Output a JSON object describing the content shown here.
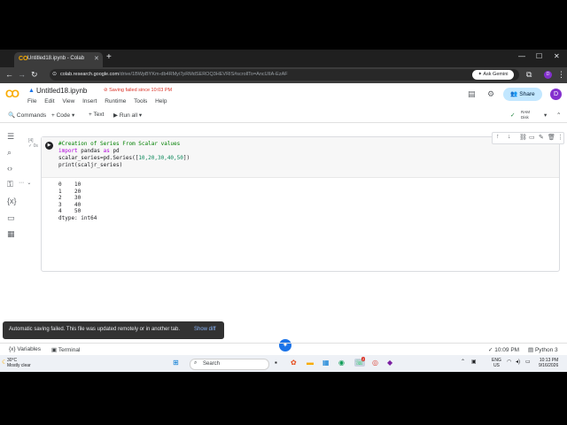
{
  "browser": {
    "tab_title": "Untitled18.ipynb - Colab",
    "url_domain": "colab.research.google.com",
    "url_path": "/drive/1BWpBYKm-db4RMyi7pRMdSEROQ3HEVRIS#scrollTo=AncUIIA-EzAF",
    "gemini_label": "Ask Gemini",
    "profile_initial": "D"
  },
  "colab": {
    "notebook_title": "Untitled18.ipynb",
    "saving_status": "Saving failed since 10:03 PM",
    "menu": [
      "File",
      "Edit",
      "View",
      "Insert",
      "Runtime",
      "Tools",
      "Help"
    ],
    "share_label": "Share",
    "avatar_initial": "D",
    "toolbar": {
      "commands": "Commands",
      "code": "+ Code",
      "text": "+ Text",
      "run_all": "Run all",
      "ram": "RAM",
      "disk": "Disk"
    }
  },
  "cell": {
    "exec_count": "[4]",
    "exec_time": "0s",
    "code": {
      "comment": "#Creation of Series From Scalar values",
      "line2_kw": "import",
      "line2_rest": " pandas ",
      "line2_kw2": "as",
      "line2_alias": " pd",
      "line3_pre": "scalar_series=pd.Series([",
      "line3_nums": "10,20,30,40,50",
      "line3_post": "])",
      "line4": "print(scaljr_series)"
    },
    "output": [
      "0    10",
      "1    20",
      "2    30",
      "3    40",
      "4    50",
      "dtype: int64"
    ]
  },
  "toast": {
    "message": "Automatic saving failed. This file was updated remotely or in another tab.",
    "action": "Show diff"
  },
  "statusbar": {
    "variables": "Variables",
    "terminal": "Terminal",
    "time": "10:09 PM",
    "runtime": "Python 3"
  },
  "taskbar": {
    "temperature": "30°C",
    "weather": "Mostly clear",
    "search_label": "Search",
    "lang1": "ENG",
    "lang2": "US",
    "clock_time": "10:13 PM",
    "clock_date": "9/16/2026",
    "badge": "2"
  },
  "colors": {
    "accent": "#1a73e8",
    "error": "#d93025",
    "share_bg": "#c2e7ff",
    "logo": "#f9ab00"
  }
}
